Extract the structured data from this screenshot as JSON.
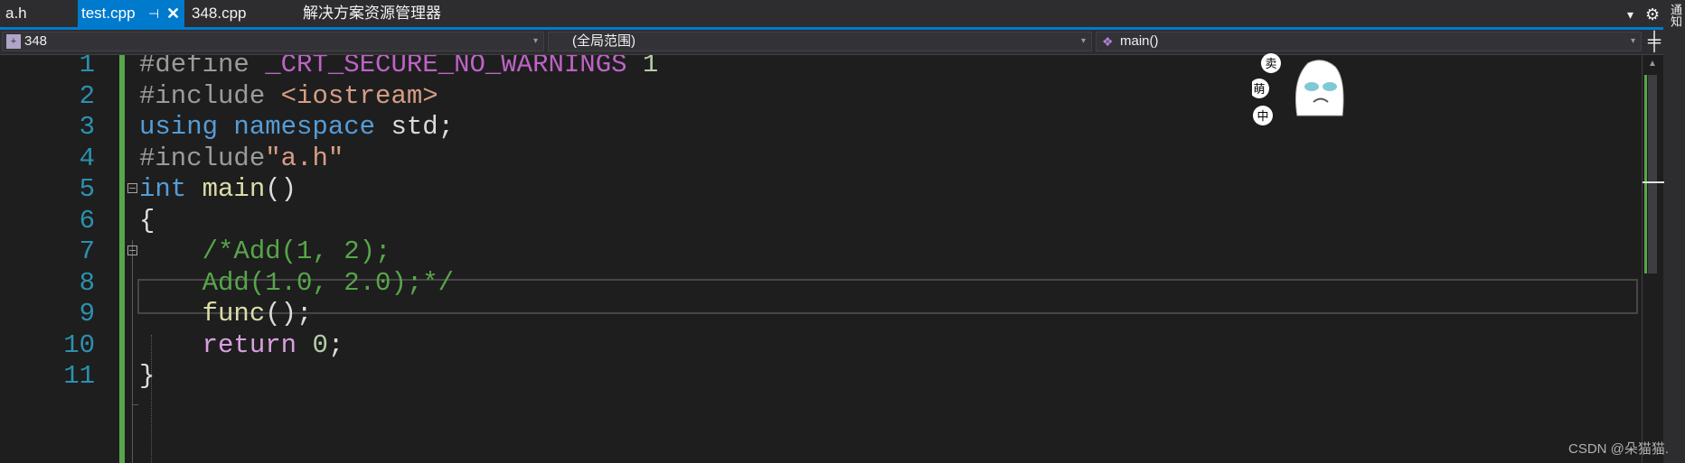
{
  "tabs": [
    {
      "label": "a.h",
      "active": false
    },
    {
      "label": "test.cpp",
      "active": true,
      "pin_glyph": "⊣",
      "close_glyph": "✕"
    },
    {
      "label": "348.cpp",
      "active": false
    },
    {
      "label": "解决方案资源管理器",
      "active": false
    }
  ],
  "tab_menu_glyph": "▾",
  "settings_glyph": "⚙",
  "right_strip_text": "通知",
  "navbar": {
    "project": "348",
    "scope": "(全局范围)",
    "member": "main()",
    "dropdown_glyph": "▾",
    "split_glyph": "╪"
  },
  "code_lines": [
    {
      "num": "1",
      "fold": "",
      "tokens": [
        {
          "c": "pp",
          "t": "#define "
        },
        {
          "c": "macro",
          "t": "_CRT_SECURE_NO_WARNINGS"
        },
        {
          "c": "plain",
          "t": " "
        },
        {
          "c": "num",
          "t": "1"
        }
      ]
    },
    {
      "num": "2",
      "fold": "",
      "tokens": [
        {
          "c": "pp",
          "t": "#include "
        },
        {
          "c": "str",
          "t": "<iostream>"
        }
      ]
    },
    {
      "num": "3",
      "fold": "",
      "tokens": [
        {
          "c": "kw",
          "t": "using"
        },
        {
          "c": "plain",
          "t": " "
        },
        {
          "c": "kw",
          "t": "namespace"
        },
        {
          "c": "plain",
          "t": " std;"
        }
      ]
    },
    {
      "num": "4",
      "fold": "",
      "tokens": [
        {
          "c": "pp",
          "t": "#include"
        },
        {
          "c": "str",
          "t": "\"a.h\""
        }
      ]
    },
    {
      "num": "5",
      "fold": "⊟",
      "tokens": [
        {
          "c": "kw",
          "t": "int"
        },
        {
          "c": "plain",
          "t": " "
        },
        {
          "c": "fn",
          "t": "main"
        },
        {
          "c": "plain",
          "t": "()"
        }
      ]
    },
    {
      "num": "6",
      "fold": "",
      "tokens": [
        {
          "c": "plain",
          "t": "{"
        }
      ]
    },
    {
      "num": "7",
      "fold": "⊟",
      "tokens": [
        {
          "c": "plain",
          "t": "    "
        },
        {
          "c": "cm",
          "t": "/*Add(1, 2);"
        }
      ]
    },
    {
      "num": "8",
      "fold": "",
      "tokens": [
        {
          "c": "plain",
          "t": "    "
        },
        {
          "c": "cm",
          "t": "Add(1.0, 2.0);*/"
        }
      ]
    },
    {
      "num": "9",
      "fold": "",
      "tokens": [
        {
          "c": "plain",
          "t": "    "
        },
        {
          "c": "fn",
          "t": "func"
        },
        {
          "c": "plain",
          "t": "();"
        }
      ]
    },
    {
      "num": "10",
      "fold": "",
      "tokens": [
        {
          "c": "plain",
          "t": "    "
        },
        {
          "c": "ctl",
          "t": "return"
        },
        {
          "c": "plain",
          "t": " "
        },
        {
          "c": "num",
          "t": "0"
        },
        {
          "c": "plain",
          "t": ";"
        }
      ]
    },
    {
      "num": "11",
      "fold": "",
      "tokens": [
        {
          "c": "plain",
          "t": "}"
        }
      ]
    }
  ],
  "sticker": {
    "bubble_top": "卖",
    "bubble_mid": "萌",
    "bubble_bot": "中"
  },
  "watermark": "CSDN @朵猫猫."
}
